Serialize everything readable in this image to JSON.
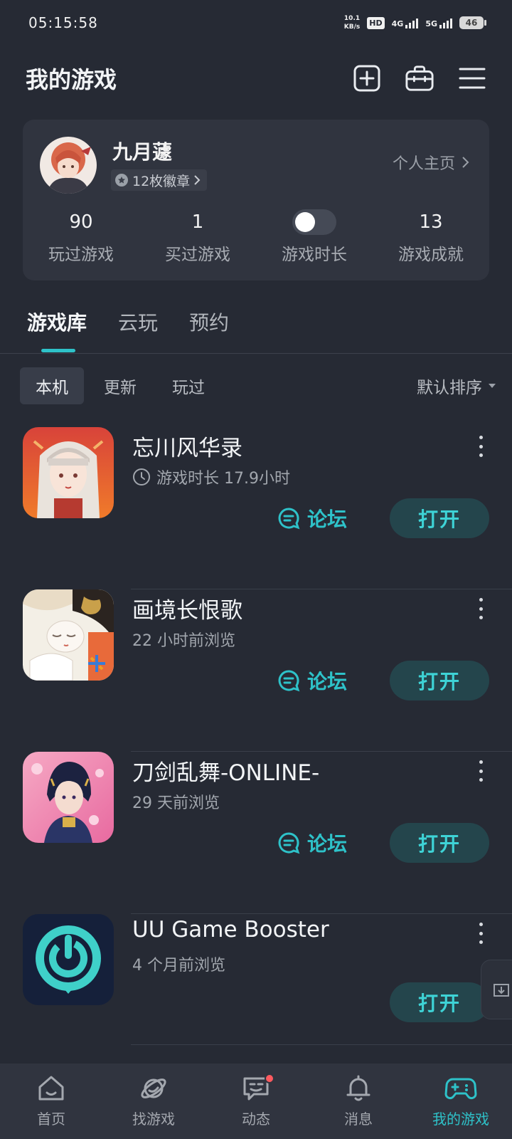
{
  "status_bar": {
    "time": "05:15:58",
    "net_speed_value": "10.1",
    "net_speed_unit": "KB/s",
    "hd_label": "HD",
    "sim1_label": "4G",
    "sim2_label": "5G",
    "battery": "46"
  },
  "header": {
    "title": "我的游戏",
    "icons": [
      "add-square-icon",
      "toolbox-icon",
      "menu-icon"
    ]
  },
  "profile": {
    "username": "九月蘧",
    "badges": "12枚徽章",
    "home_link": "个人主页",
    "stats": [
      {
        "value": "90",
        "label": "玩过游戏"
      },
      {
        "value": "1",
        "label": "买过游戏"
      },
      {
        "value": "",
        "label": "游戏时长",
        "toggle_on": false
      },
      {
        "value": "13",
        "label": "游戏成就"
      }
    ]
  },
  "main_tabs": [
    {
      "label": "游戏库",
      "active": true
    },
    {
      "label": "云玩",
      "active": false
    },
    {
      "label": "预约",
      "active": false
    }
  ],
  "filters": [
    {
      "label": "本机",
      "active": true
    },
    {
      "label": "更新",
      "active": false
    },
    {
      "label": "玩过",
      "active": false
    }
  ],
  "sort_label": "默认排序",
  "games": [
    {
      "title": "忘川风华录",
      "subtitle": "游戏时长 17.9小时",
      "show_clock": true,
      "forum_label": "论坛",
      "open_label": "打开",
      "has_forum": true
    },
    {
      "title": "画境长恨歌",
      "subtitle": "22 小时前浏览",
      "show_clock": false,
      "forum_label": "论坛",
      "open_label": "打开",
      "has_forum": true
    },
    {
      "title": "刀剑乱舞-ONLINE-",
      "subtitle": "29 天前浏览",
      "show_clock": false,
      "forum_label": "论坛",
      "open_label": "打开",
      "has_forum": true
    },
    {
      "title": "UU Game Booster",
      "subtitle": "4 个月前浏览",
      "show_clock": false,
      "forum_label": "",
      "open_label": "打开",
      "has_forum": false
    }
  ],
  "bottom_nav": [
    {
      "label": "首页",
      "icon": "home-icon",
      "active": false
    },
    {
      "label": "找游戏",
      "icon": "planet-icon",
      "active": false
    },
    {
      "label": "动态",
      "icon": "chat-icon",
      "active": false,
      "notification": true
    },
    {
      "label": "消息",
      "icon": "bell-icon",
      "active": false
    },
    {
      "label": "我的游戏",
      "icon": "gamepad-icon",
      "active": true
    }
  ],
  "colors": {
    "background": "#262a34",
    "card": "#30343f",
    "accent": "#2ec2c9",
    "open_button_bg": "#24454c",
    "notification": "#ff5a5f"
  }
}
